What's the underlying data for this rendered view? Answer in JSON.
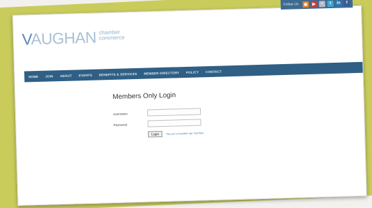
{
  "follow": {
    "label": "Follow Us",
    "icons": [
      {
        "name": "rss-icon",
        "color": "#e8822a",
        "glyph": "◉"
      },
      {
        "name": "youtube-icon",
        "color": "#d23a3a",
        "glyph": "▶"
      },
      {
        "name": "flickr-icon",
        "color": "#b9b9c9",
        "glyph": "•"
      },
      {
        "name": "twitter-icon",
        "color": "#3aa7d6",
        "glyph": "t"
      },
      {
        "name": "linkedin-icon",
        "color": "#2c77b3",
        "glyph": "in"
      },
      {
        "name": "facebook-icon",
        "color": "#3b5a98",
        "glyph": "f"
      }
    ]
  },
  "logo": {
    "v": "V",
    "rest": "AUGHAN",
    "sub_line1": "chamber",
    "sub_line2": "commerce",
    "of": "of"
  },
  "nav": {
    "items": [
      "HOME",
      "JOIN",
      "ABOUT",
      "EVENTS",
      "BENEFITS & SERVICES",
      "MEMBER DIRECTORY",
      "POLICY",
      "CONTACT"
    ]
  },
  "login": {
    "title": "Members Only Login",
    "username_label": "Username:",
    "password_label": "Password:",
    "username_value": "",
    "password_value": "",
    "button_label": "Login",
    "forgot_text": "Not yet a member apr member"
  },
  "colors": {
    "accent_bg": "#c9cc5b",
    "nav_bg": "#2f5f84",
    "logo_primary": "#5a86b3"
  }
}
